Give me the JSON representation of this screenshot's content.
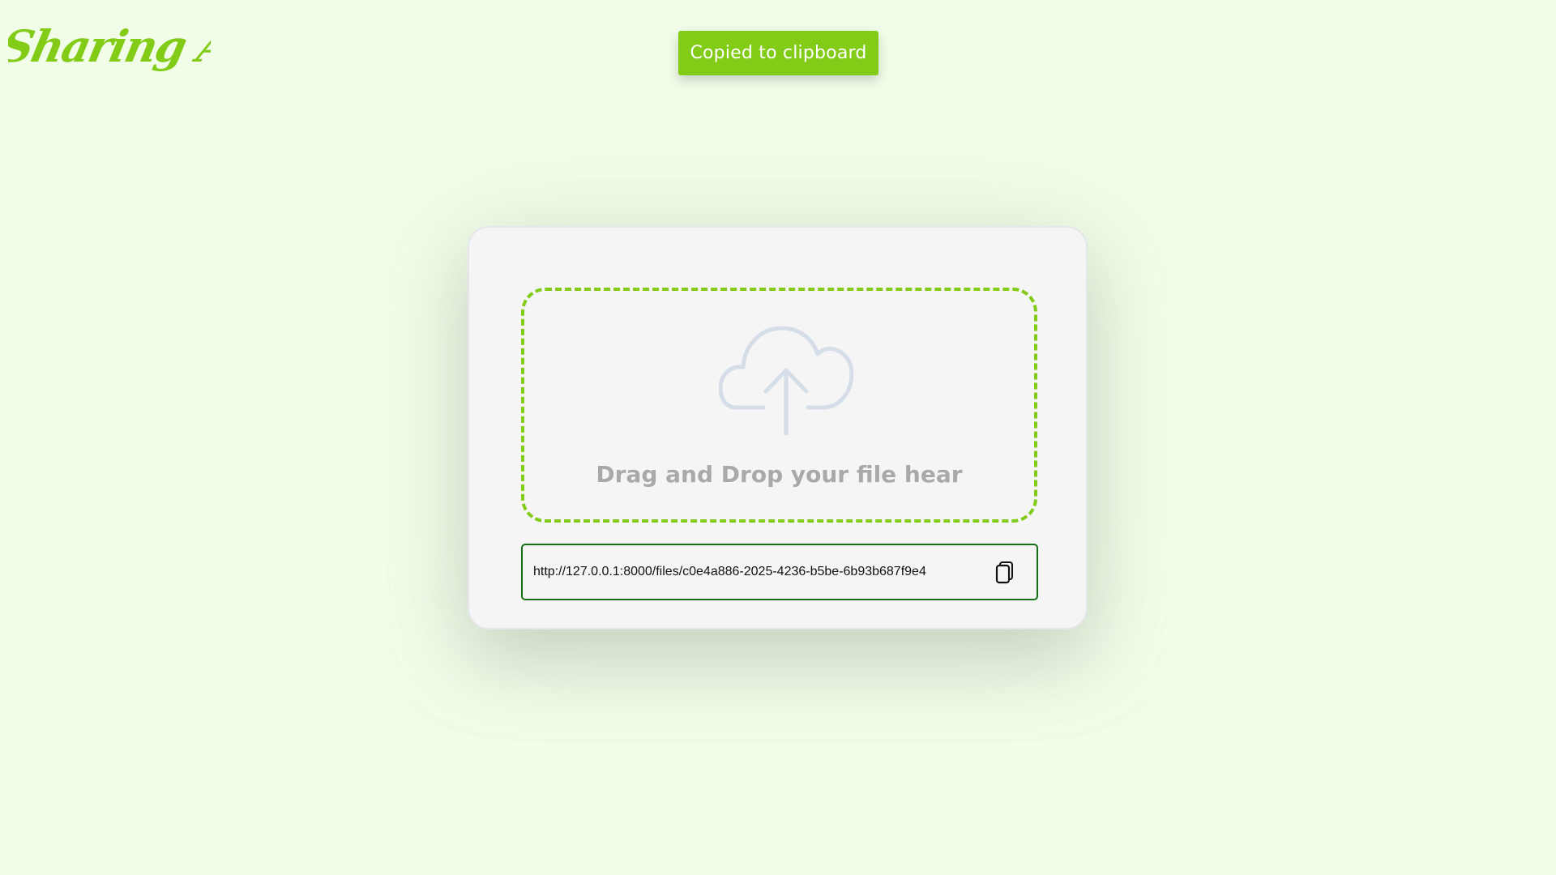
{
  "app": {
    "logo_text": "Sharing App",
    "logo_color": "#82cc18"
  },
  "toast": {
    "message": "Copied to clipboard",
    "background": "#82cc18"
  },
  "upload": {
    "icon": "cloud-upload-icon",
    "drop_text": "Drag and Drop your file hear",
    "border_color": "#82cc18"
  },
  "share": {
    "link": "http://127.0.0.1:8000/files/c0e4a886-2025-4236-b5be-6b93b687f9e4",
    "copy_icon": "copy-icon",
    "border_color": "#147014"
  }
}
